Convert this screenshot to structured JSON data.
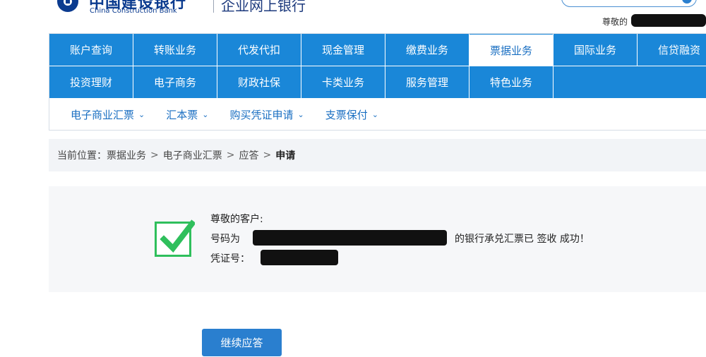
{
  "header": {
    "bank_name_cn": "中国建设银行",
    "bank_name_en": "China Construction Bank",
    "sub_brand": "企业网上银行",
    "welcome": "尊敬的"
  },
  "nav": {
    "row1": [
      "账户查询",
      "转账业务",
      "代发代扣",
      "现金管理",
      "缴费业务",
      "票据业务",
      "国际业务",
      "信贷融资"
    ],
    "row2": [
      "投资理财",
      "电子商务",
      "财政社保",
      "卡类业务",
      "服务管理",
      "特色业务"
    ],
    "active": "票据业务"
  },
  "subnav": {
    "items": [
      "电子商业汇票",
      "汇本票",
      "购买凭证申请",
      "支票保付"
    ],
    "caret": "⌄"
  },
  "breadcrumb": {
    "prefix": "当前位置：",
    "items": [
      "票据业务",
      "电子商业汇票",
      "应答"
    ],
    "separator": ">",
    "current": "申请"
  },
  "result": {
    "greeting": "尊敬的客户:",
    "number_label": "号码为",
    "success_text": "的银行承兑汇票已 签收 成功！",
    "voucher_label": "凭证号："
  },
  "actions": {
    "continue_label": "继续应答"
  },
  "colors": {
    "nav_blue": "#1a87d8",
    "brand_blue": "#0b3b8f",
    "success_green": "#2fbf5c",
    "button_blue": "#2a7fcf"
  }
}
